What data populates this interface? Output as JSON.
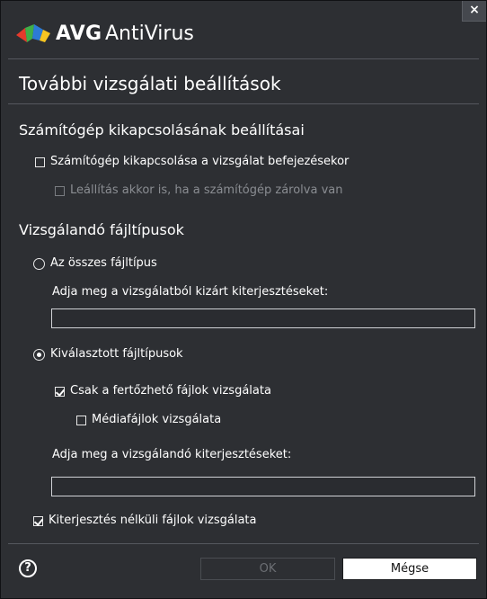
{
  "window": {
    "brand": "AVG",
    "product": "AntiVirus",
    "close_label": "×"
  },
  "page_title": "További vizsgálati beállítások",
  "shutdown": {
    "heading": "Számítógép kikapcsolásának beállításai",
    "shutdown_after_scan": {
      "label": "Számítógép kikapcsolása a vizsgálat befejezésekor",
      "checked": false
    },
    "force_if_locked": {
      "label": "Leállítás akkor is, ha a számítógép zárolva van",
      "checked": false,
      "enabled": false
    }
  },
  "file_types": {
    "heading": "Vizsgálandó fájltípusok",
    "all_types": {
      "label": "Az összes fájltípus",
      "selected": false
    },
    "exclude_prompt": "Adja meg a vizsgálatból kizárt kiterjesztéseket:",
    "exclude_value": "",
    "selected_types": {
      "label": "Kiválasztott fájltípusok",
      "selected": true
    },
    "infectable_only": {
      "label": "Csak a fertőzhető fájlok vizsgálata",
      "checked": true
    },
    "media_files": {
      "label": "Médiafájlok vizsgálata",
      "checked": false
    },
    "include_prompt": "Adja meg a vizsgálandó kiterjesztéseket:",
    "include_value": "",
    "no_extension": {
      "label": "Kiterjesztés nélküli fájlok vizsgálata",
      "checked": true
    }
  },
  "footer": {
    "help_label": "?",
    "ok_label": "OK",
    "cancel_label": "Mégse"
  },
  "colors": {
    "background": "#2d2f33",
    "text": "#ffffff",
    "disabled_text": "#8a8d92",
    "logo_red": "#e53a2c",
    "logo_green": "#3fae49",
    "logo_blue": "#2c7bd6",
    "logo_yellow": "#f6c521"
  }
}
